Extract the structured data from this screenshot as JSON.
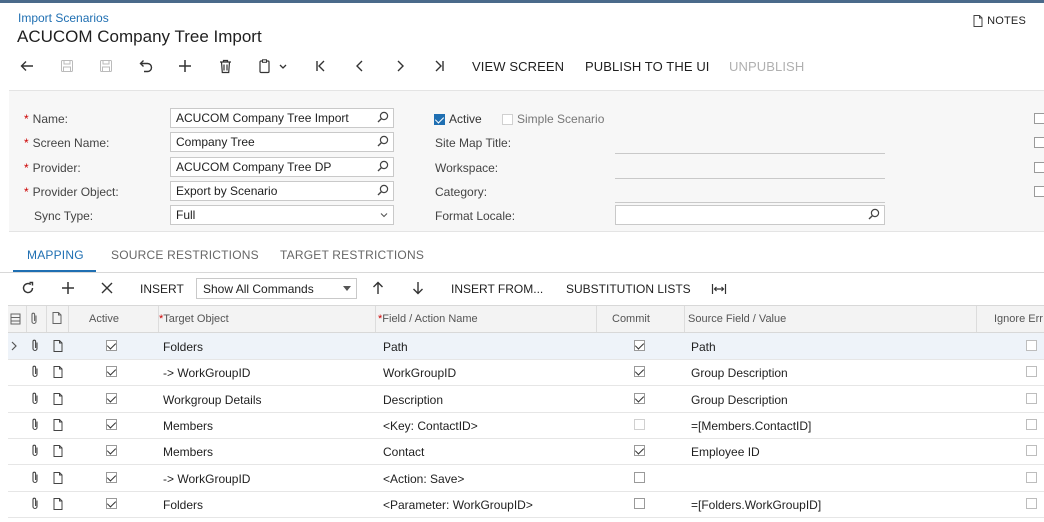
{
  "breadcrumb": "Import Scenarios",
  "title": "ACUCOM Company Tree Import",
  "notes_label": "NOTES",
  "toolbar": {
    "icons": [
      "back-icon",
      "save-close-icon",
      "save-icon",
      "undo-icon",
      "add-icon",
      "delete-icon",
      "copy-paste-icon",
      "first-icon",
      "prev-icon",
      "next-icon",
      "last-icon"
    ],
    "view_screen": "VIEW SCREEN",
    "publish": "PUBLISH TO THE UI",
    "unpublish": "UNPUBLISH"
  },
  "form": {
    "name_label": "Name:",
    "name_value": "ACUCOM Company Tree Import",
    "screen_label": "Screen Name:",
    "screen_value": "Company Tree",
    "provider_label": "Provider:",
    "provider_value": "ACUCOM Company Tree DP",
    "provider_object_label": "Provider Object:",
    "provider_object_value": "Export by Scenario",
    "sync_type_label": "Sync Type:",
    "sync_type_value": "Full",
    "active_label": "Active",
    "active_checked": true,
    "simple_label": "Simple Scenario",
    "simple_checked": false,
    "sitemap_label": "Site Map Title:",
    "workspace_label": "Workspace:",
    "category_label": "Category:",
    "format_locale_label": "Format Locale:",
    "format_locale_value": ""
  },
  "tabs": [
    "MAPPING",
    "SOURCE RESTRICTIONS",
    "TARGET RESTRICTIONS"
  ],
  "grid_toolbar": {
    "insert": "INSERT",
    "commands_select": "Show All Commands",
    "insert_from": "INSERT FROM...",
    "substitution": "SUBSTITUTION LISTS"
  },
  "columns": {
    "active": "Active",
    "target_object": "Target Object",
    "field_action": "Field / Action Name",
    "commit": "Commit",
    "source_field": "Source Field / Value",
    "ignore": "Ignore Err"
  },
  "rows": [
    {
      "active": true,
      "target": "Folders",
      "field": "Path",
      "commit": true,
      "commit_disabled": false,
      "source": "Path",
      "ignore": false
    },
    {
      "active": true,
      "target": "-> WorkGroupID",
      "field": "WorkGroupID",
      "commit": true,
      "commit_disabled": false,
      "source": "Group Description",
      "ignore": false
    },
    {
      "active": true,
      "target": "Workgroup Details",
      "field": "Description",
      "commit": true,
      "commit_disabled": false,
      "source": "Group Description",
      "ignore": false
    },
    {
      "active": true,
      "target": "Members",
      "field": "<Key: ContactID>",
      "commit": false,
      "commit_disabled": true,
      "source": "=[Members.ContactID]",
      "ignore": false
    },
    {
      "active": true,
      "target": "Members",
      "field": "Contact",
      "commit": true,
      "commit_disabled": false,
      "source": "Employee ID",
      "ignore": false
    },
    {
      "active": true,
      "target": "-> WorkGroupID",
      "field": "<Action: Save>",
      "commit": false,
      "commit_disabled": false,
      "source": "",
      "ignore": false
    },
    {
      "active": true,
      "target": "Folders",
      "field": "<Parameter: WorkGroupID>",
      "commit": false,
      "commit_disabled": false,
      "source": "=[Folders.WorkGroupID]",
      "ignore": false
    }
  ]
}
